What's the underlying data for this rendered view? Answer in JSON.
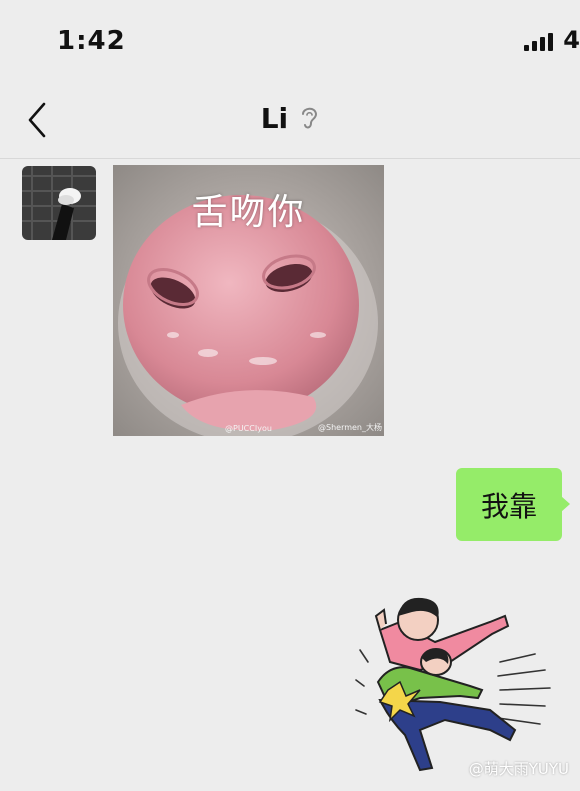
{
  "status_bar": {
    "time": "1:42",
    "battery_digit": "4"
  },
  "nav": {
    "title": "Li",
    "back_icon": "chevron-left-icon",
    "voice_icon": "ear-icon"
  },
  "messages": [
    {
      "side": "left",
      "kind": "sticker",
      "caption": "舌吻你",
      "watermark_1": "@PUCCIyou",
      "watermark_2": "@Shermen_大杨"
    },
    {
      "side": "right",
      "kind": "text",
      "text": "我靠"
    },
    {
      "side": "right",
      "kind": "sticker",
      "description": "cartoon figures tackling"
    }
  ],
  "watermark": "@萌大雨YUYU",
  "colors": {
    "background": "#ededed",
    "bubble_green": "#95ec69"
  }
}
